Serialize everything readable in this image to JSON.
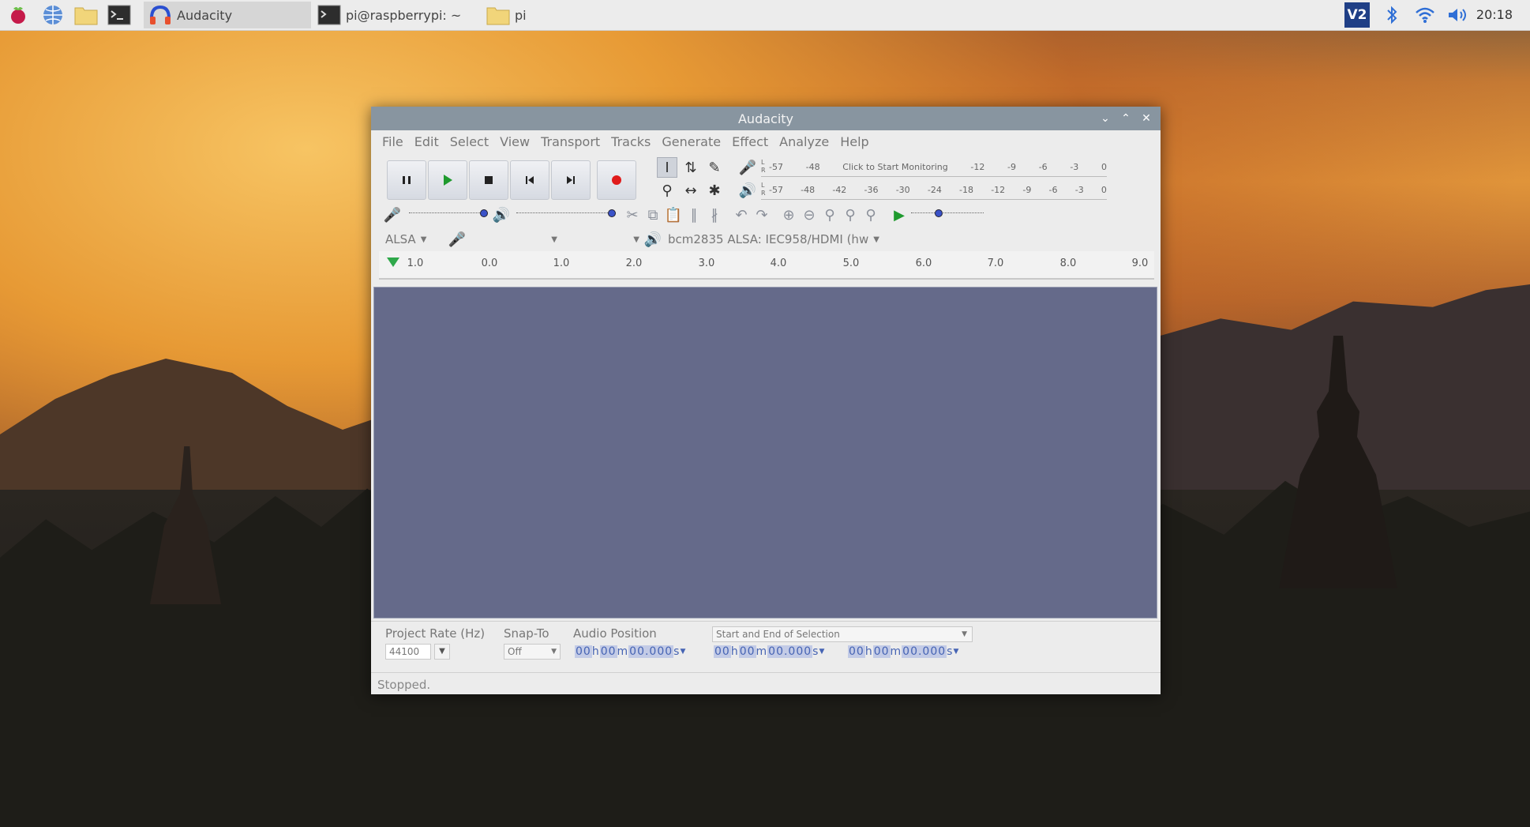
{
  "taskbar": {
    "tasks": [
      {
        "label": "Audacity",
        "icon": "audacity-headphones-icon",
        "active": true
      },
      {
        "label": "pi@raspberrypi: ~",
        "icon": "terminal-icon",
        "active": false
      },
      {
        "label": "pi",
        "icon": "folder-icon",
        "active": false
      }
    ],
    "launchers": [
      "raspberry-menu-icon",
      "web-browser-icon",
      "file-manager-icon",
      "terminal-icon"
    ],
    "tray": {
      "vnc_label": "V2",
      "clock": "20:18"
    }
  },
  "window": {
    "title": "Audacity",
    "menu": [
      "File",
      "Edit",
      "Select",
      "View",
      "Transport",
      "Tracks",
      "Generate",
      "Effect",
      "Analyze",
      "Help"
    ],
    "meters": {
      "record_scale": [
        "-57",
        "-48",
        "Click to Start Monitoring",
        "-12",
        "-9",
        "-6",
        "-3",
        "0"
      ],
      "play_scale": [
        "-57",
        "-48",
        "-42",
        "-36",
        "-30",
        "-24",
        "-18",
        "-12",
        "-9",
        "-6",
        "-3",
        "0"
      ],
      "lr": "L\nR"
    },
    "device": {
      "host": "ALSA",
      "playback_device": "bcm2835 ALSA: IEC958/HDMI (hw"
    },
    "ruler": [
      "1.0",
      "0.0",
      "1.0",
      "2.0",
      "3.0",
      "4.0",
      "5.0",
      "6.0",
      "7.0",
      "8.0",
      "9.0"
    ],
    "selection_toolbar": {
      "project_rate_label": "Project Rate (Hz)",
      "project_rate": "44100",
      "snap_to_label": "Snap-To",
      "snap_to": "Off",
      "audio_position_label": "Audio Position",
      "selection_mode": "Start and End of Selection",
      "time_value": [
        "00",
        "h",
        "00",
        "m",
        "00.000",
        "s"
      ]
    },
    "status": "Stopped."
  }
}
